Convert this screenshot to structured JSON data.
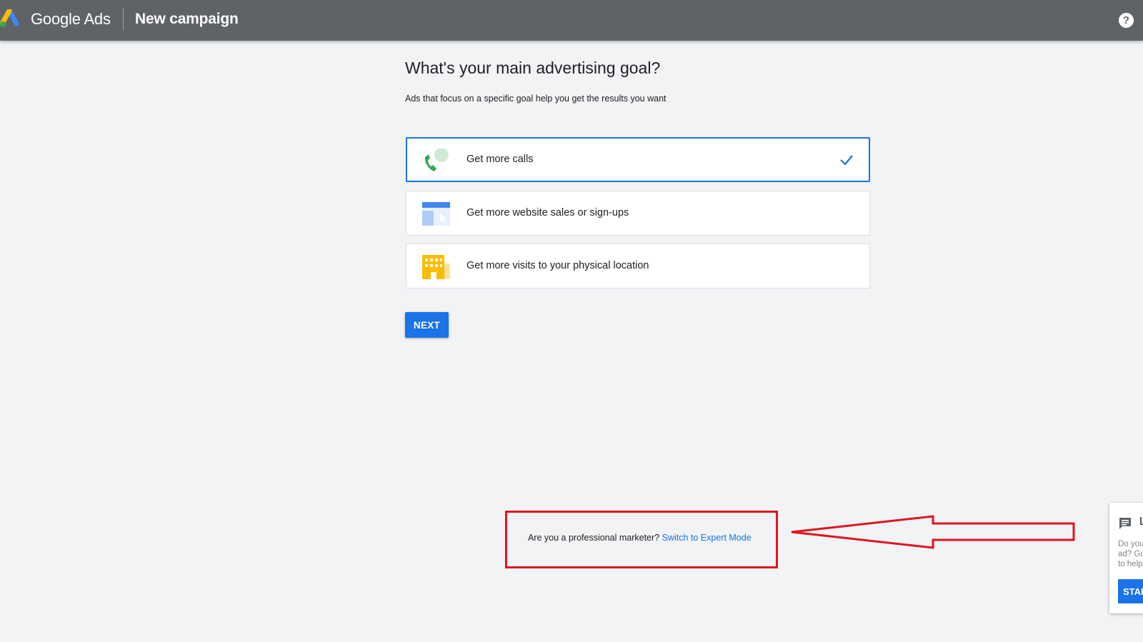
{
  "header": {
    "brand": "Google Ads",
    "title": "New campaign",
    "help_icon": "help-circle-icon",
    "help_glyph": "?"
  },
  "main": {
    "heading": "What's your main advertising goal?",
    "subheading": "Ads that focus on a specific goal help you get the results you want",
    "goals": [
      {
        "label": "Get more calls",
        "icon": "phone-call-icon",
        "selected": true
      },
      {
        "label": "Get more website sales or sign-ups",
        "icon": "website-icon",
        "selected": false
      },
      {
        "label": "Get more visits to your physical location",
        "icon": "building-icon",
        "selected": false
      }
    ],
    "next_label": "NEXT"
  },
  "expert": {
    "question": "Are you a professional marketer?",
    "link": "Switch to Expert Mode"
  },
  "feedback": {
    "title": "L",
    "body_lines": [
      "Do you",
      "ad? Go",
      "to help"
    ],
    "start_label": "STAR"
  },
  "colors": {
    "header_bg": "#5f6368",
    "page_bg": "#f1f3f4",
    "accent_blue": "#1a73e8",
    "annotation_red": "#e0141e"
  }
}
